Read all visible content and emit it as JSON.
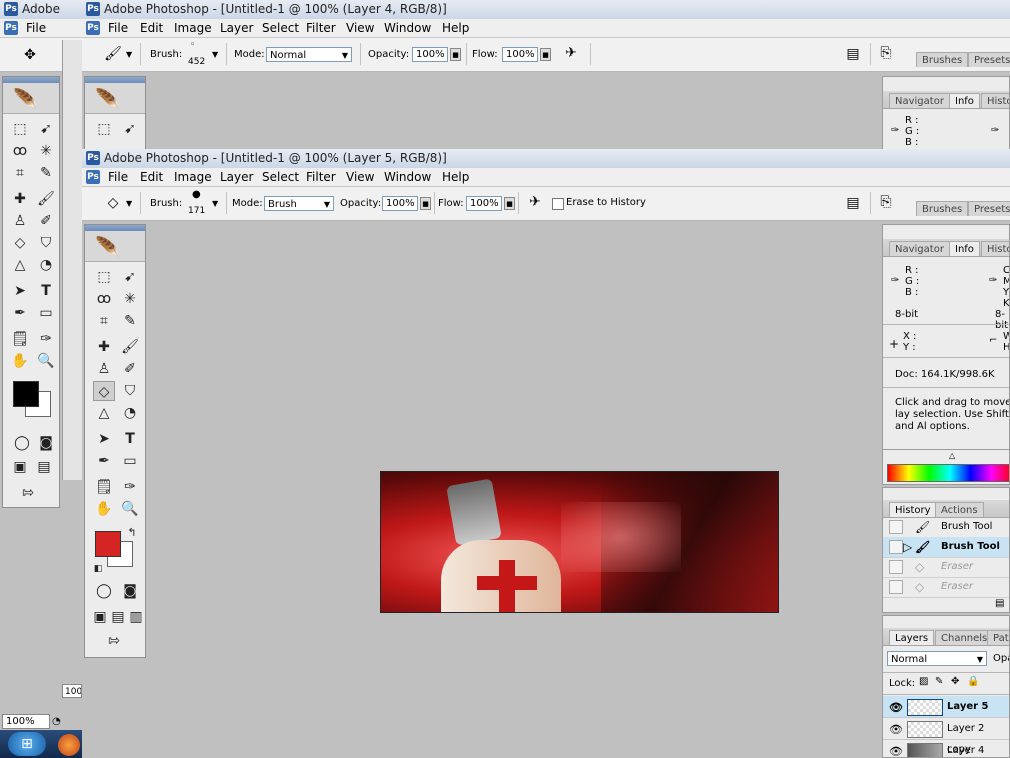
{
  "window1": {
    "title": "Adobe Photoshop - [Untitled-1 @ 100% (Layer 4, RGB/8)]",
    "menu": [
      "File",
      "Edit",
      "Image",
      "Layer",
      "Select",
      "Filter",
      "View",
      "Window",
      "Help"
    ],
    "options": {
      "brush_label": "Brush:",
      "brush_size": "452",
      "mode_label": "Mode:",
      "mode_value": "Normal",
      "opacity_label": "Opacity:",
      "opacity_value": "100%",
      "flow_label": "Flow:",
      "flow_value": "100%"
    },
    "panel_tabs": [
      "Brushes",
      "Presets"
    ],
    "info_tabs": [
      "Navigator",
      "Info",
      "Histo"
    ],
    "info_labels": [
      "R :",
      "G :",
      "B :"
    ]
  },
  "window2": {
    "title": "Adobe Photoshop - [Untitled-1 @ 100% (Layer 5, RGB/8)]",
    "menu": [
      "File",
      "Edit",
      "Image",
      "Layer",
      "Select",
      "Filter",
      "View",
      "Window",
      "Help"
    ],
    "options": {
      "brush_label": "Brush:",
      "brush_size": "171",
      "mode_label": "Mode:",
      "mode_value": "Brush",
      "opacity_label": "Opacity:",
      "opacity_value": "100%",
      "flow_label": "Flow:",
      "flow_value": "100%",
      "erase_history_label": "Erase to History"
    },
    "panel_tabs": [
      "Brushes",
      "Presets"
    ]
  },
  "background_window": {
    "title": "Adobe",
    "menu": [
      "File"
    ]
  },
  "info_panel": {
    "tabs": [
      "Navigator",
      "Info",
      "Histo"
    ],
    "rgb_labels": [
      "R :",
      "G :",
      "B :"
    ],
    "bit_depth": "8-bit",
    "right_labels": [
      "C",
      "M",
      "Y",
      "K"
    ],
    "right_bit": "8-bit",
    "xy_labels": [
      "X :",
      "Y :"
    ],
    "wh_labels": [
      "W",
      "H"
    ],
    "doc_size": "Doc: 164.1K/998.6K",
    "hint": "Click and drag to move lay selection.  Use Shift and Al options."
  },
  "history_panel": {
    "tabs": [
      "History",
      "Actions"
    ],
    "items": [
      {
        "label": "Brush Tool",
        "state": "normal"
      },
      {
        "label": "Brush Tool",
        "state": "current"
      },
      {
        "label": "Eraser",
        "state": "undone"
      },
      {
        "label": "Eraser",
        "state": "undone"
      }
    ]
  },
  "layers_panel": {
    "tabs": [
      "Layers",
      "Channels",
      "Path"
    ],
    "blend_mode": "Normal",
    "opacity_label": "Opa",
    "lock_label": "Lock:",
    "layers": [
      {
        "name": "Layer 5",
        "selected": true
      },
      {
        "name": "Layer 2 copy",
        "selected": false
      },
      {
        "name": "Layer 4",
        "selected": false
      }
    ]
  },
  "status": {
    "zoom_main": "100%",
    "zoom_small": "100"
  },
  "colors": {
    "foreground_win1": "#000000",
    "foreground_win2": "#d42424",
    "background": "#ffffff",
    "canvas_bg": "#c0c0c0",
    "selected_row": "#c8e4f4"
  }
}
